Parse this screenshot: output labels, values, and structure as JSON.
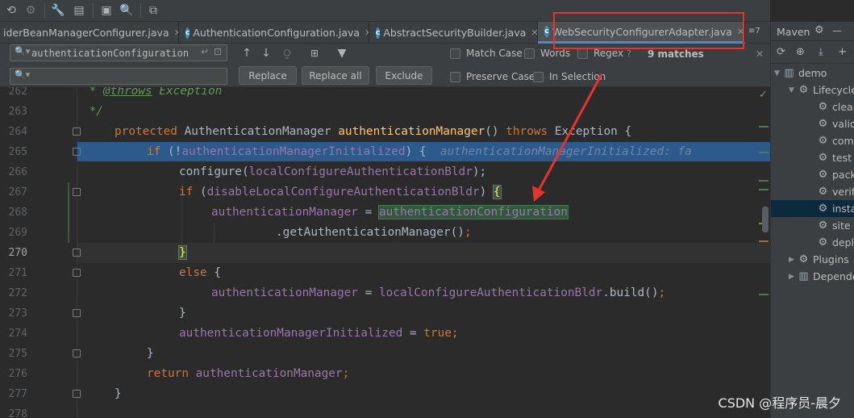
{
  "toolbar": {
    "icons": [
      "undo-icon",
      "settings-gear-icon",
      "wrench-icon",
      "project-structure-icon",
      "terminal-icon",
      "search-icon",
      "translate-icon"
    ]
  },
  "tabs": [
    {
      "label": "iderBeanManagerConfigurer.java",
      "icon": "",
      "active": false
    },
    {
      "label": "AuthenticationConfiguration.java",
      "icon": "c",
      "active": false
    },
    {
      "label": "AbstractSecurityBuilder.java",
      "icon": "c",
      "active": false
    },
    {
      "label": "WebSecurityConfigurerAdapter.java",
      "icon": "c",
      "active": true
    }
  ],
  "tab_overflow_label": "≡7",
  "find": {
    "search_value": "authenticationConfiguration",
    "replace_value": "",
    "replace_label": "Replace",
    "replace_all_label": "Replace all",
    "exclude_label": "Exclude",
    "match_case": "Match Case",
    "words": "Words",
    "regex": "Regex",
    "regex_help": "?",
    "matches": "9 matches",
    "preserve_case": "Preserve Case",
    "in_selection": "In Selection"
  },
  "editor": {
    "lines": [
      {
        "num": "262"
      },
      {
        "num": "263"
      },
      {
        "num": "264"
      },
      {
        "num": "265"
      },
      {
        "num": "266"
      },
      {
        "num": "267"
      },
      {
        "num": "268"
      },
      {
        "num": "269"
      },
      {
        "num": "270"
      },
      {
        "num": "271"
      },
      {
        "num": "272"
      },
      {
        "num": "273"
      },
      {
        "num": "274"
      },
      {
        "num": "275"
      },
      {
        "num": "276"
      },
      {
        "num": "277"
      },
      {
        "num": "278"
      }
    ],
    "code": {
      "l262_star": " * ",
      "l262_tag": "@throws",
      "l262_rest": " Exception",
      "l263": " */",
      "l264_kw": "protected",
      "l264_type": " AuthenticationManager ",
      "l264_method": "authenticationManager",
      "l264_parens": "() ",
      "l264_throws": "throws",
      "l264_rest": " Exception {",
      "l265_if": "if",
      "l265_open": " (!",
      "l265_field": "authenticationManagerInitialized",
      "l265_close": ") {  ",
      "l265_hint": "authenticationManagerInitialized: fa",
      "l266": "configure(",
      "l266_field": "localConfigureAuthenticationBldr",
      "l266_end": ");",
      "l267_if": "if",
      "l267_open": " (",
      "l267_field": "disableLocalConfigureAuthenticationBldr",
      "l267_close": ") ",
      "l267_brace": "{",
      "l268_field": "authenticationManager",
      "l268_eq": " = ",
      "l268_match": "authenticationConfiguration",
      "l269": ".getAuthenticationManager()",
      "l269_semi": ";",
      "l270_brace": "}",
      "l271_else": "else",
      "l271_brace": " {",
      "l272_field": "authenticationManager",
      "l272_eq": " = ",
      "l272_field2": "localConfigureAuthenticationBldr",
      "l272_call": ".build()",
      "l272_semi": ";",
      "l273": "}",
      "l274_field": "authenticationManagerInitialized",
      "l274_eq": " = ",
      "l274_true": "true",
      "l274_semi": ";",
      "l275": "}",
      "l276_kw": "return",
      "l276_field": " authenticationManager",
      "l276_semi": ";",
      "l277": "}"
    }
  },
  "maven": {
    "title": "Maven",
    "tree": [
      {
        "label": "demo",
        "level": 0,
        "expanded": true,
        "icon": "maven-project-icon"
      },
      {
        "label": "Lifecycle",
        "level": 1,
        "expanded": true,
        "icon": "folder-gear-icon"
      },
      {
        "label": "clean",
        "level": 2,
        "icon": "gear-icon"
      },
      {
        "label": "validate",
        "level": 2,
        "icon": "gear-icon"
      },
      {
        "label": "compile",
        "level": 2,
        "icon": "gear-icon"
      },
      {
        "label": "test",
        "level": 2,
        "icon": "gear-icon"
      },
      {
        "label": "package",
        "level": 2,
        "icon": "gear-icon"
      },
      {
        "label": "verify",
        "level": 2,
        "icon": "gear-icon"
      },
      {
        "label": "install",
        "level": 2,
        "icon": "gear-icon",
        "selected": true
      },
      {
        "label": "site",
        "level": 2,
        "icon": "gear-icon"
      },
      {
        "label": "deploy",
        "level": 2,
        "icon": "gear-icon"
      },
      {
        "label": "Plugins",
        "level": 1,
        "expanded": false,
        "icon": "folder-gear-icon"
      },
      {
        "label": "Dependencies",
        "level": 1,
        "expanded": false,
        "icon": "library-icon"
      }
    ]
  },
  "watermark": "CSDN @程序员-晨夕",
  "colors": {
    "annotation_red": "#e8322e",
    "selection_blue": "#2d5a8c",
    "match_green": "#32593d"
  }
}
